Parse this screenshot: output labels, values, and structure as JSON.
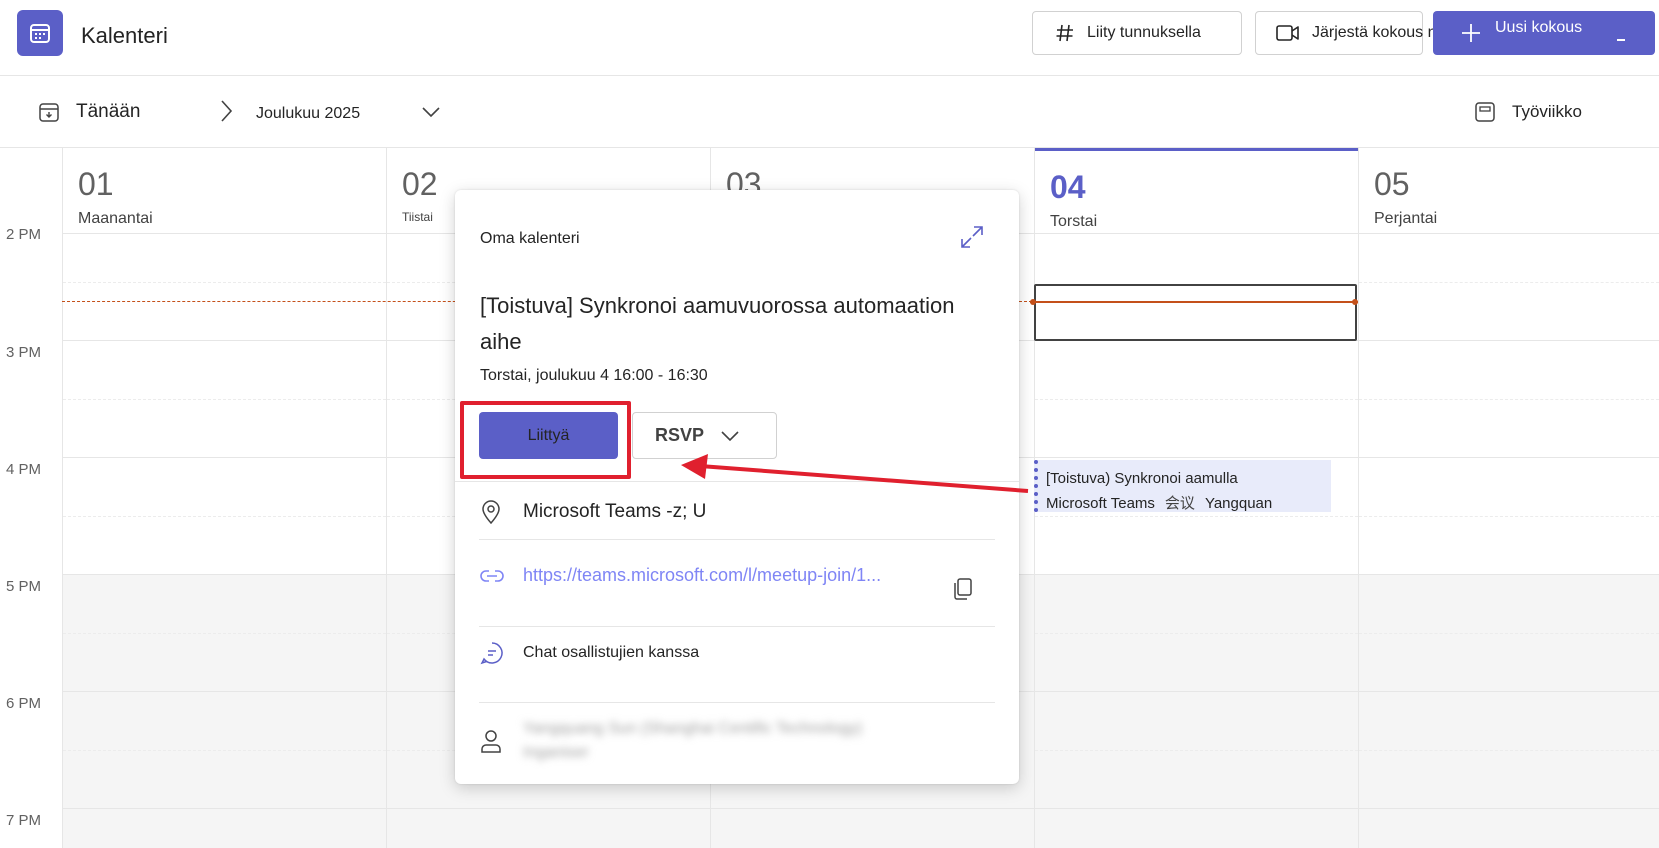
{
  "header": {
    "app_title": "Kalenteri",
    "join_with_code_label": "Liity tunnuksella",
    "meet_now_label": "Järjestä kokous nyt",
    "new_meeting_label": "Uusi kokous",
    "accent_color": "#5b5fc7"
  },
  "nav": {
    "today_label": "Tänään",
    "month_label": "Joulukuu 2025",
    "view_label": "Työviikko"
  },
  "days": [
    {
      "num": "01",
      "name": "Maanantai"
    },
    {
      "num": "02",
      "name": "Tiistai"
    },
    {
      "num": "03",
      "name": ""
    },
    {
      "num": "04",
      "name": "Torstai"
    },
    {
      "num": "05",
      "name": "Perjantai"
    }
  ],
  "time_labels": [
    "2 PM",
    "3 PM",
    "4 PM",
    "5 PM",
    "6 PM",
    "7 PM"
  ],
  "event": {
    "line1": "[Toistuva) Synkronoi aamulla",
    "line2a": "Microsoft Teams",
    "line2b": "会议",
    "line2c": "Yangquan"
  },
  "popup": {
    "calendar_name": "Oma kalenteri",
    "title": "[Toistuva] Synkronoi aamuvuorossa automaation aihe",
    "time": "Torstai, joulukuu 4 16:00 - 16:30",
    "join_label": "Liittyä",
    "rsvp_label": "RSVP",
    "location": "Microsoft Teams -z; U",
    "link": "https://teams.microsoft.com/l/meetup-join/1...",
    "chat_label": "Chat osallistujien kanssa",
    "organizer_name": "Yangquang Sun (Shanghai Centific Technology)",
    "organizer_role": "Inganiser"
  },
  "annotation": {
    "color": "#e0202e"
  }
}
